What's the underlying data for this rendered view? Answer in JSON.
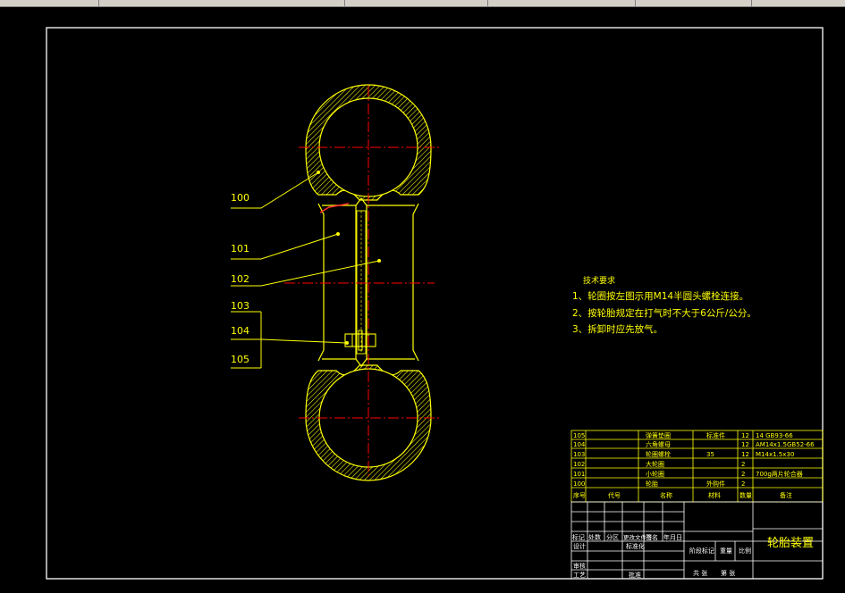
{
  "balloons": [
    {
      "label": "100"
    },
    {
      "label": "101"
    },
    {
      "label": "102"
    },
    {
      "label": "103"
    },
    {
      "label": "104"
    },
    {
      "label": "105"
    }
  ],
  "tech_requirements": {
    "title": "技术要求",
    "lines": [
      "1、轮圈按左图示用M14半圆头螺栓连接。",
      "2、按轮胎规定在打气时不大于6公斤/公分。",
      "3、拆卸时应先放气。"
    ]
  },
  "parts_list": {
    "rows": [
      {
        "no": "105",
        "code": "",
        "name": "弹簧垫圈",
        "qty": "12",
        "material": "标准件",
        "mat_qty": "",
        "note": "14 GB93-66"
      },
      {
        "no": "104",
        "code": "",
        "name": "六角螺母",
        "qty": "12",
        "material": "",
        "mat_qty": "",
        "note": "AM14x1.5GB52-66"
      },
      {
        "no": "103",
        "code": "",
        "name": "轮圈螺栓",
        "qty": "12",
        "material": "35",
        "mat_qty": "",
        "note": "M14x1.5x30"
      },
      {
        "no": "102",
        "code": "",
        "name": "大轮圈",
        "qty": "2",
        "material": "",
        "mat_qty": "",
        "note": ""
      },
      {
        "no": "101",
        "code": "",
        "name": "小轮圈",
        "qty": "2",
        "material": "",
        "mat_qty": "",
        "note": "700g两片轮合器"
      },
      {
        "no": "100",
        "code": "",
        "name": "轮胎",
        "qty": "2",
        "material": "外购件",
        "mat_qty": "",
        "note": ""
      }
    ],
    "header": {
      "no": "序号",
      "code": "代号",
      "name": "名称",
      "qty": "数量",
      "material": "材料",
      "note": "备注"
    }
  },
  "title_block": {
    "drawing_title": "轮胎装置",
    "mark": "标记",
    "count": "处数",
    "zone": "分区",
    "change_doc": "更改文件号",
    "signature": "签名",
    "date": "年月日",
    "designer": "设计",
    "standardize": "标准化",
    "stage_mark": "阶段标记",
    "weight": "重量",
    "scale": "比例",
    "review": "审核",
    "process": "工艺",
    "approve": "批准",
    "sheets_total": "共  张",
    "sheet_no": "第  张"
  },
  "colors": {
    "background": "#000000",
    "outline": "#ffff00",
    "text": "#ffffff",
    "centerline": "#ff0000",
    "frame": "#ffffff"
  }
}
